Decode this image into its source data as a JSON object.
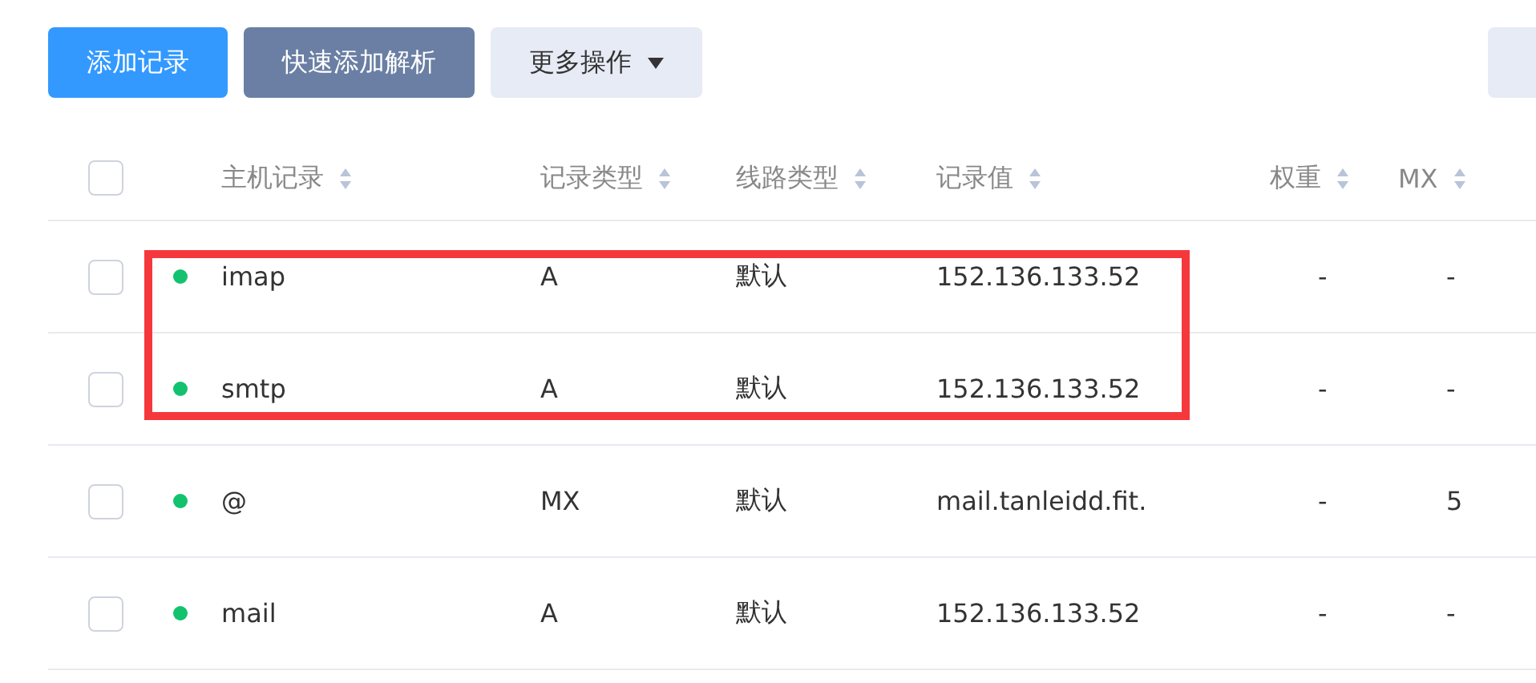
{
  "toolbar": {
    "buttons": [
      {
        "label": "添加记录",
        "kind": "primary"
      },
      {
        "label": "快速添加解析",
        "kind": "secondary"
      },
      {
        "label": "更多操作",
        "kind": "dropdown"
      },
      {
        "kind": "cut"
      }
    ]
  },
  "table": {
    "header_checked": false,
    "columns": [
      "主机记录",
      "记录类型",
      "线路类型",
      "记录值",
      "权重",
      "MX"
    ],
    "rows": [
      {
        "checked": false,
        "enabled": true,
        "highlighted": true,
        "cells": [
          "imap",
          "A",
          "默认",
          "152.136.133.52",
          "-",
          "-"
        ]
      },
      {
        "checked": false,
        "enabled": true,
        "highlighted": true,
        "cells": [
          "smtp",
          "A",
          "默认",
          "152.136.133.52",
          "-",
          "-"
        ]
      },
      {
        "checked": false,
        "enabled": true,
        "highlighted": false,
        "cells": [
          "@",
          "MX",
          "默认",
          "mail.tanleidd.fit.",
          "-",
          "5"
        ]
      },
      {
        "checked": false,
        "enabled": true,
        "highlighted": false,
        "cells": [
          "mail",
          "A",
          "默认",
          "152.136.133.52",
          "-",
          "-"
        ]
      }
    ]
  }
}
